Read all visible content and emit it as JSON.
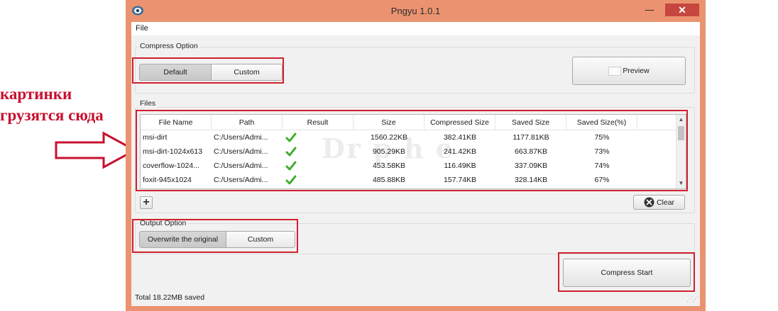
{
  "annotation": {
    "line1": "картинки",
    "line2": "грузятся сюда",
    "arrow_icon": "right-arrow-outline",
    "color": "#c8102e"
  },
  "window": {
    "title": "Pngyu 1.0.1",
    "app_icon": "pngyu-app-icon",
    "minimize_icon": "minimize-icon",
    "maximize_icon": "maximize-icon",
    "close_icon": "close-icon",
    "accent_color": "#eb9370"
  },
  "menu": {
    "file": "File"
  },
  "compress_option": {
    "label": "Compress Option",
    "default_label": "Default",
    "custom_label": "Custom",
    "selected": "Default"
  },
  "preview": {
    "label": "Preview",
    "icon": "image-preview-icon"
  },
  "files": {
    "label": "Files",
    "columns": [
      "File Name",
      "Path",
      "Result",
      "Size",
      "Compressed Size",
      "Saved Size",
      "Saved Size(%)"
    ],
    "rows": [
      {
        "name": "msi-dirt",
        "path": "C:/Users/Admi...",
        "result": "check",
        "size": "1560.22KB",
        "compressed": "382.41KB",
        "saved": "1177.81KB",
        "pct": "75%"
      },
      {
        "name": "msi-dirt-1024x613",
        "path": "C:/Users/Admi...",
        "result": "check",
        "size": "905.29KB",
        "compressed": "241.42KB",
        "saved": "663.87KB",
        "pct": "73%"
      },
      {
        "name": "coverflow-1024...",
        "path": "C:/Users/Admi...",
        "result": "check",
        "size": "453.58KB",
        "compressed": "116.49KB",
        "saved": "337.09KB",
        "pct": "74%"
      },
      {
        "name": "foxit-945x1024",
        "path": "C:/Users/Admi...",
        "result": "check",
        "size": "485.88KB",
        "compressed": "157.74KB",
        "saved": "328.14KB",
        "pct": "67%"
      }
    ],
    "watermark": "Dr  p  h  e",
    "add_label": "+",
    "clear_label": "Clear",
    "clear_icon": "clear-x-icon"
  },
  "output_option": {
    "label": "Output Option",
    "overwrite_label": "Overwrite the original",
    "custom_label": "Custom",
    "selected": "Overwrite the original"
  },
  "compress_start": {
    "label": "Compress Start"
  },
  "status": {
    "text": "Total 18.22MB saved"
  },
  "highlight_color": "#d0202e"
}
